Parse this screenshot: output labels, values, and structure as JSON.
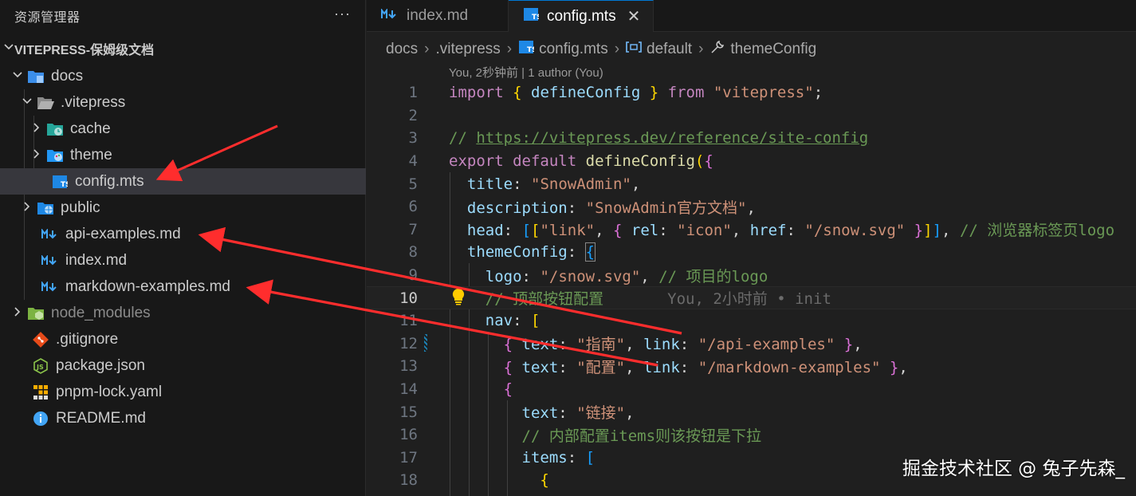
{
  "sidebar": {
    "title": "资源管理器",
    "more": "···",
    "project": "VITEPRESS-保姆级文档",
    "items": [
      {
        "label": "docs",
        "icon": "folder-docs-icon"
      },
      {
        "label": ".vitepress",
        "icon": "folder-open-icon"
      },
      {
        "label": "cache",
        "icon": "folder-cache-icon"
      },
      {
        "label": "theme",
        "icon": "folder-theme-icon"
      },
      {
        "label": "config.mts",
        "icon": "typescript-file-icon"
      },
      {
        "label": "public",
        "icon": "folder-public-icon"
      },
      {
        "label": "api-examples.md",
        "icon": "markdown-file-icon"
      },
      {
        "label": "index.md",
        "icon": "markdown-file-icon"
      },
      {
        "label": "markdown-examples.md",
        "icon": "markdown-file-icon"
      },
      {
        "label": "node_modules",
        "icon": "folder-node-icon"
      },
      {
        "label": ".gitignore",
        "icon": "git-icon"
      },
      {
        "label": "package.json",
        "icon": "nodejs-icon"
      },
      {
        "label": "pnpm-lock.yaml",
        "icon": "pnpm-icon"
      },
      {
        "label": "README.md",
        "icon": "info-icon"
      }
    ]
  },
  "tabs": [
    {
      "label": "index.md",
      "icon": "markdown-file-icon",
      "active": false
    },
    {
      "label": "config.mts",
      "icon": "typescript-file-icon",
      "active": true,
      "close": "✕"
    }
  ],
  "breadcrumb": [
    "docs",
    ".vitepress",
    "config.mts",
    "default",
    "themeConfig"
  ],
  "codelens": "You, 2秒钟前 | 1 author (You)",
  "editor": {
    "current_line": 10,
    "line_numbers": [
      "1",
      "2",
      "3",
      "4",
      "5",
      "6",
      "7",
      "8",
      "9",
      "10",
      "11",
      "12",
      "13",
      "14",
      "15",
      "16",
      "17",
      "18"
    ],
    "blame": "You, 2小时前 • init",
    "lines": {
      "l1": [
        "import",
        "{",
        "defineConfig",
        "}",
        "from",
        "\"vitepress\"",
        ";"
      ],
      "l3": [
        "// ",
        "https://vitepress.dev/reference/site-config"
      ],
      "l4": [
        "export",
        "default",
        "defineConfig",
        "(",
        "{"
      ],
      "l5": [
        "title",
        ":",
        "\"SnowAdmin\"",
        ","
      ],
      "l6": [
        "description",
        ":",
        "\"SnowAdmin官方文档\"",
        ","
      ],
      "l7": [
        "head",
        ":",
        "[",
        "[",
        "\"link\"",
        ",",
        "{",
        "rel",
        ":",
        "\"icon\"",
        ",",
        "href",
        ":",
        "\"/snow.svg\"",
        "}",
        "]",
        "]",
        ",",
        "// 浏览器标签页logo"
      ],
      "l8": [
        "themeConfig",
        ":",
        "{"
      ],
      "l9": [
        "logo",
        ":",
        "\"/snow.svg\"",
        ",",
        "// 项目的logo"
      ],
      "l10": [
        "// 顶部按钮配置"
      ],
      "l11": [
        "nav",
        ":",
        "["
      ],
      "l12": [
        "{",
        "text",
        ":",
        "\"指南\"",
        ",",
        "link",
        ":",
        "\"/api-examples\"",
        "}",
        ","
      ],
      "l13": [
        "{",
        "text",
        ":",
        "\"配置\"",
        ",",
        "link",
        ":",
        "\"/markdown-examples\"",
        "}",
        ","
      ],
      "l14": [
        "{"
      ],
      "l15": [
        "text",
        ":",
        "\"链接\"",
        ","
      ],
      "l16": [
        "// 内部配置items则该按钮是下拉"
      ],
      "l17": [
        "items",
        ":",
        "["
      ],
      "l18": [
        "{"
      ]
    }
  },
  "watermark": "掘金技术社区 @ 兔子先森_",
  "colors": {
    "arrow": "#ff2d2d",
    "selection": "#37373d",
    "accent": "#0078d4"
  }
}
